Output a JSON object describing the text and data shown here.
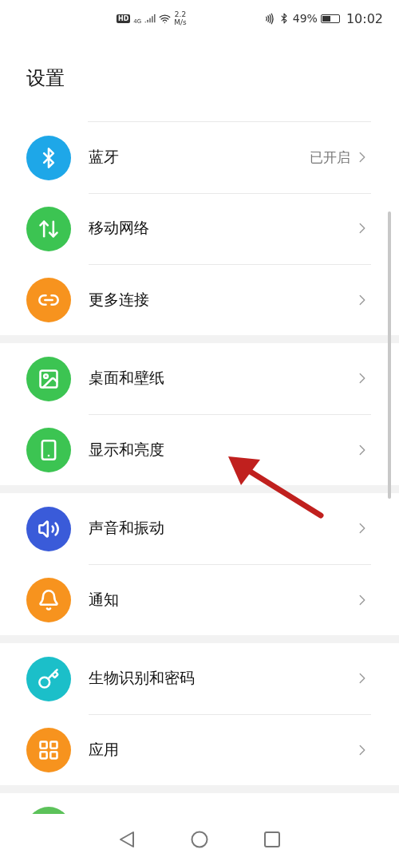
{
  "status_bar": {
    "hd": "HD",
    "network": "4G",
    "speed_value": "2.2",
    "speed_unit": "M/s",
    "battery": "49%",
    "time": "10:02"
  },
  "title": "设置",
  "groups": [
    {
      "items": [
        {
          "color": "#1ea7e8",
          "label": "蓝牙",
          "value": "已开启"
        },
        {
          "color": "#3cc452",
          "label": "移动网络"
        },
        {
          "color": "#f7931e",
          "label": "更多连接"
        }
      ]
    },
    {
      "items": [
        {
          "color": "#3cc452",
          "label": "桌面和壁纸"
        },
        {
          "color": "#3cc452",
          "label": "显示和亮度"
        }
      ]
    },
    {
      "items": [
        {
          "color": "#3a5bd9",
          "label": "声音和振动"
        },
        {
          "color": "#f7931e",
          "label": "通知"
        }
      ]
    },
    {
      "items": [
        {
          "color": "#1bbfc9",
          "label": "生物识别和密码"
        },
        {
          "color": "#f7931e",
          "label": "应用"
        }
      ]
    }
  ],
  "peek_item": {
    "color": "#5cc25a"
  }
}
